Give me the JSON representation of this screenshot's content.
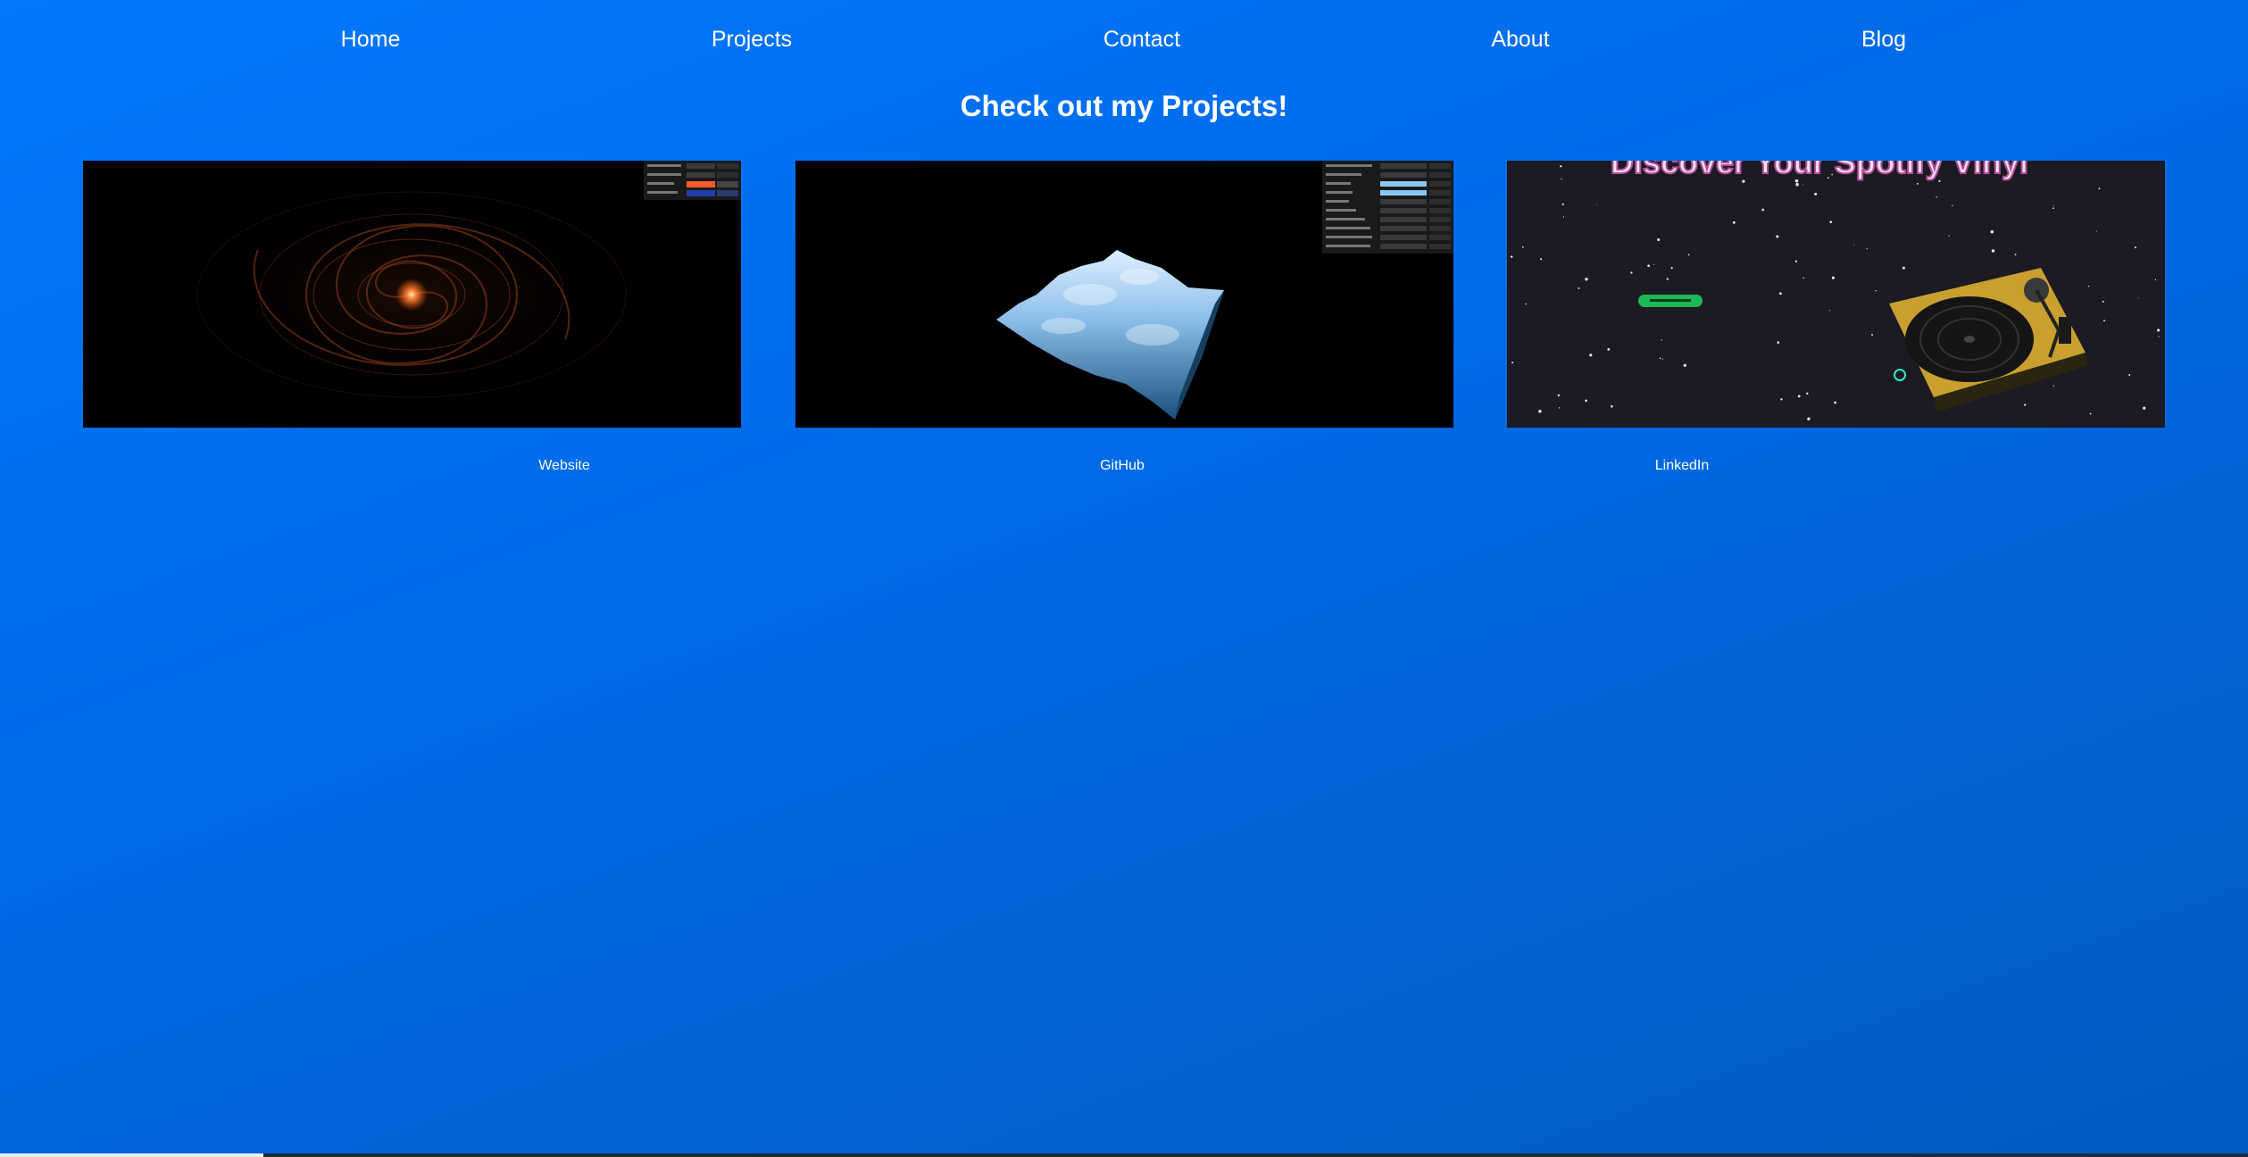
{
  "nav": {
    "items": [
      "Home",
      "Projects",
      "Contact",
      "About",
      "Blog"
    ]
  },
  "heading": "Check out my Projects!",
  "projects": [
    {
      "image": "galaxy-particle-simulation",
      "link": "Website"
    },
    {
      "image": "3d-terrain-generator",
      "link": "GitHub"
    },
    {
      "image": "spotify-vinyl-turntable",
      "banner": "Discover Your Spotify Vinyl",
      "link": "LinkedIn"
    }
  ],
  "colors": {
    "background_start": "#0078ff",
    "background_end": "#005cc4",
    "text": "#ffffff",
    "galaxy_core": "#ff8a3d",
    "spotify_green": "#1db954",
    "turntable_gold": "#c9a030"
  },
  "scrollbar": {
    "position": 0.117
  }
}
